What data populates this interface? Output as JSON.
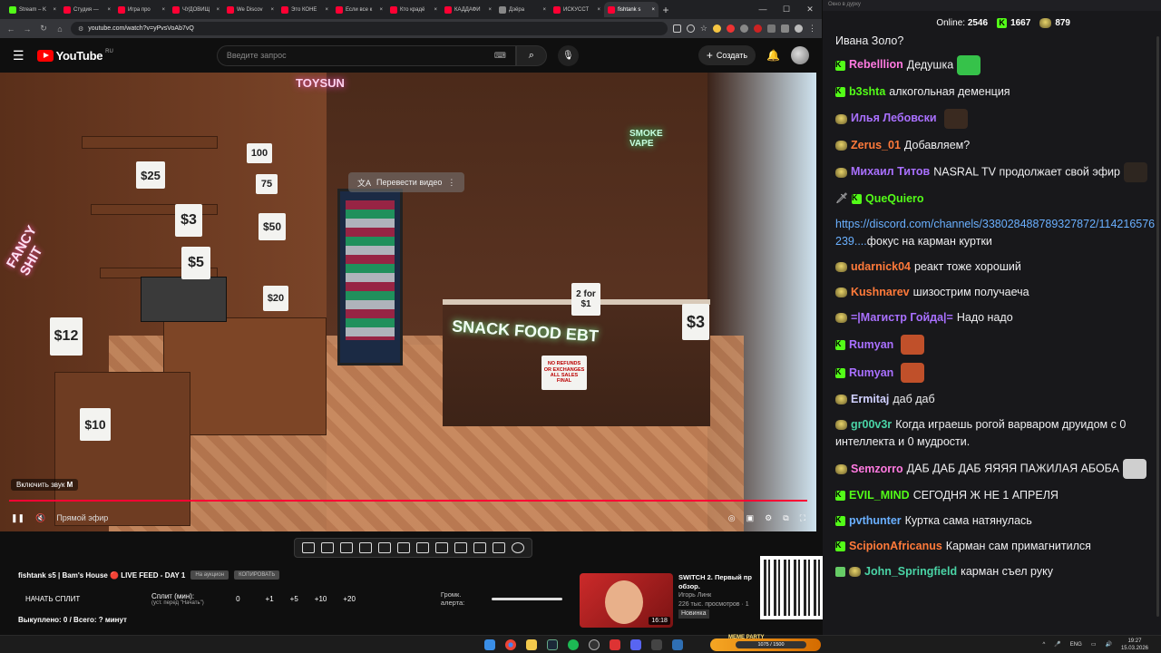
{
  "browser": {
    "tabs": [
      {
        "label": "Stream – K",
        "color": "#53fc18"
      },
      {
        "label": "Студия —",
        "color": "#ff0033"
      },
      {
        "label": "Игра про",
        "color": "#ff0033"
      },
      {
        "label": "ЧУДОВИЩ",
        "color": "#ff0033"
      },
      {
        "label": "We Discov",
        "color": "#ff0033"
      },
      {
        "label": "Это КОНЕ",
        "color": "#ff0033"
      },
      {
        "label": "Если все к",
        "color": "#ff0033"
      },
      {
        "label": "Кто крадё",
        "color": "#ff0033"
      },
      {
        "label": "КАДДАФИ",
        "color": "#ff0033"
      },
      {
        "label": "Дзёра",
        "color": "#888888"
      },
      {
        "label": "ИСКУССТ",
        "color": "#ff0033"
      },
      {
        "label": "fishtank s",
        "color": "#ff0033",
        "active": true
      }
    ],
    "url": "youtube.com/watch?v=yPvsVoAb7vQ"
  },
  "youtube": {
    "logo_text": "YouTube",
    "logo_region": "RU",
    "search_placeholder": "Введите запрос",
    "create_label": "Создать"
  },
  "video": {
    "translate_label": "Перевести видео",
    "unmute_label": "Включить звук",
    "unmute_key": "M",
    "live_label": "Прямой эфир",
    "scene_signs": {
      "p25": "$25",
      "p3": "$3",
      "p50": "$50",
      "p5": "$5",
      "p20": "$20",
      "p12": "$12",
      "p10": "$10",
      "p100": "100",
      "p75": "75",
      "twofor": "2 for $1",
      "p3b": "$3",
      "snack": "SNACK FOOD EBT",
      "norefunds": "NO REFUNDS OR EXCHANGES ALL SALES FINAL",
      "fancy": "FANCY SHIT",
      "tipsy": "TOYSUN",
      "smoke": "SMOKE VAPE"
    }
  },
  "meta": {
    "title": "fishtank s5 | Bam's House 🔴 LIVE FEED - DAY 1",
    "chip_auction": "На аукцион",
    "chip_copy": "КОПИРОВАТЬ",
    "start_split": "НАЧАТЬ СПЛИТ",
    "split_time_label": "Сплит (мин):",
    "split_time_hint": "(уст. перед \"Начать\")",
    "split_values": [
      "0",
      "+1",
      "+5",
      "+10",
      "+20"
    ],
    "alert_volume": "Громк. алерта:",
    "bought": "Выкуплено: 0 / Всего: ? минут"
  },
  "recommended": {
    "title": "SWITCH 2. Первый пр",
    "title2": "обзор.",
    "channel": "Игорь Линк",
    "views": "226 тыс. просмотров · 1",
    "badge": "Новинка",
    "duration": "16:18"
  },
  "chat": {
    "window_title": "Окно в дурку",
    "online_label": "Online:",
    "online_count": "2546",
    "kick_count": "1667",
    "other_count": "879",
    "messages": [
      {
        "user": "",
        "text": "Ивана Золо?",
        "color": "#efeff1",
        "badge": "none"
      },
      {
        "user": "Rebelllion",
        "text": "Дедушка",
        "color": "#ff7ae0",
        "badge": "kick",
        "emote": "#36c24a"
      },
      {
        "user": "b3shta",
        "text": "алкогольная деменция",
        "color": "#53fc18",
        "badge": "kick"
      },
      {
        "user": "Илья Лебовски",
        "text": "",
        "color": "#a970ff",
        "badge": "dude",
        "emote": "#3a2a20"
      },
      {
        "user": "Zerus_01",
        "text": "Добавляем?",
        "color": "#ff7a3a",
        "badge": "dude"
      },
      {
        "user": "Михаил Титов",
        "text": "NASRAL TV продолжает свой эфир",
        "color": "#a970ff",
        "badge": "dude",
        "emote": "#2e2620"
      },
      {
        "user": "QueQuiero",
        "text": "",
        "color": "#53fc18",
        "badge": "sword"
      },
      {
        "user": "",
        "text": "https://discord.com/channels/338028488789327872/114216576239....",
        "color": "#6ab0ff",
        "badge": "none",
        "tail": "фокус на карман куртки"
      },
      {
        "user": "udarnick04",
        "text": "реакт тоже хороший",
        "color": "#ff7a3a",
        "badge": "dude"
      },
      {
        "user": "Kushnarev",
        "text": "шизострим получаеча",
        "color": "#ff7a3a",
        "badge": "dude"
      },
      {
        "user": "=|Магистр Гойда|=",
        "text": "Надо надо",
        "color": "#a970ff",
        "badge": "dude"
      },
      {
        "user": "Rumyan",
        "text": "",
        "color": "#a970ff",
        "badge": "kick",
        "emote": "#c0502a"
      },
      {
        "user": "Rumyan",
        "text": "",
        "color": "#a970ff",
        "badge": "kick",
        "emote": "#c0502a"
      },
      {
        "user": "Ermitaj",
        "text": "даб даб",
        "color": "#d0d0ff",
        "badge": "dude"
      },
      {
        "user": "gr00v3r",
        "text": "Когда играешь рогой варваром друидом с 0 интеллекта и 0 мудрости.",
        "color": "#4ad4a6",
        "badge": "dude"
      },
      {
        "user": "Semzorro",
        "text": "ДАБ ДАБ ДАБ ЯЯЯЯ ПАЖИЛАЯ АБОБА",
        "color": "#ff7ae0",
        "badge": "dude",
        "emote": "#cfcfcf"
      },
      {
        "user": "EVIL_MIND",
        "text": "СЕГОДНЯ Ж НЕ 1 АПРЕЛЯ",
        "color": "#53fc18",
        "badge": "kick"
      },
      {
        "user": "pvthunter",
        "text": "Куртка сама натянулась",
        "color": "#6ab0ff",
        "badge": "kick"
      },
      {
        "user": "ScipionAfricanus",
        "text": "Карман сам примагнитился",
        "color": "#ff7a3a",
        "badge": "kick"
      },
      {
        "user": "John_Springfield",
        "text": "карман съел руку",
        "color": "#4ad4a6",
        "badge": "two"
      }
    ]
  },
  "taskbar": {
    "meme_title": "MEME PARTY",
    "meme_progress": "1075 / 1500",
    "lang": "ENG",
    "time": "19:27",
    "date": "15.03.2026"
  },
  "colors": {
    "kick_green": "#53fc18",
    "yt_red": "#ff0000",
    "progress_red": "#ff0033"
  }
}
